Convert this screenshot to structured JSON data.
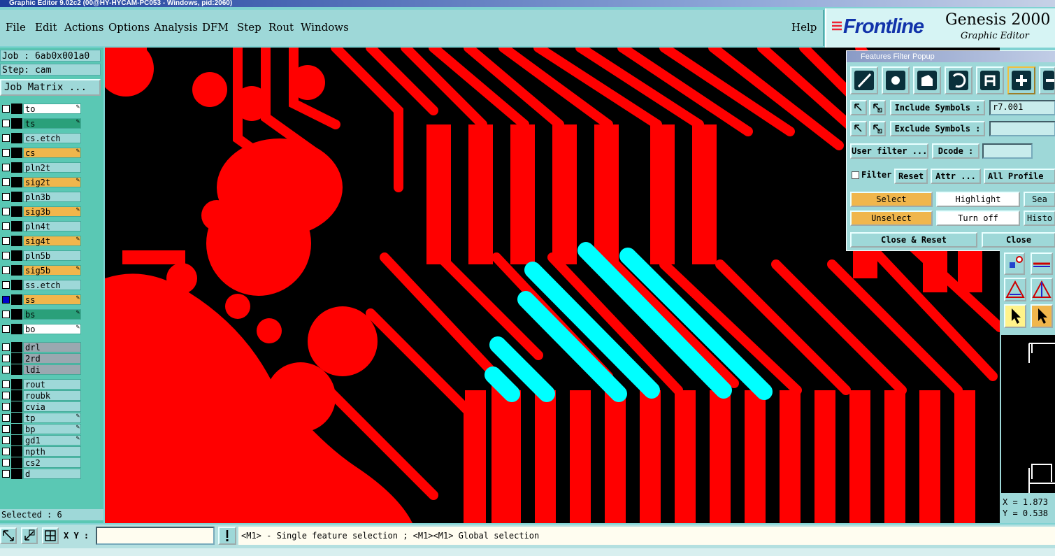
{
  "window": {
    "title": "Graphic Editor 9.02c2 (00@HY-HYCAM-PC053 - Windows, pid:2060)"
  },
  "menu": {
    "items": [
      "File",
      "Edit",
      "Actions",
      "Options",
      "Analysis",
      "DFM",
      "Step",
      "Rout",
      "Windows"
    ],
    "help": "Help"
  },
  "brand": {
    "logo": "Frontline",
    "product": "Genesis 2000",
    "subtitle": "Graphic Editor"
  },
  "job": {
    "job_label": "Job : 6ab0x001a0",
    "step_label": "Step: cam",
    "matrix_button": "Job Matrix ..."
  },
  "layers": [
    {
      "name": "to",
      "color": "#ffffff",
      "mark": "✎"
    },
    {
      "name": "ts",
      "color": "#2aa07a",
      "mark": "✎"
    },
    {
      "name": "cs.etch",
      "color": "#9ed8d8",
      "mark": ""
    },
    {
      "name": "cs",
      "color": "#f0b64c",
      "mark": "✎"
    },
    {
      "name": "pln2t",
      "color": "#9ed8d8",
      "mark": ""
    },
    {
      "name": "sig2t",
      "color": "#f0b64c",
      "mark": "✎"
    },
    {
      "name": "pln3b",
      "color": "#9ed8d8",
      "mark": ""
    },
    {
      "name": "sig3b",
      "color": "#f0b64c",
      "mark": "✎"
    },
    {
      "name": "pln4t",
      "color": "#9ed8d8",
      "mark": ""
    },
    {
      "name": "sig4t",
      "color": "#f0b64c",
      "mark": "✎"
    },
    {
      "name": "pln5b",
      "color": "#9ed8d8",
      "mark": ""
    },
    {
      "name": "sig5b",
      "color": "#f0b64c",
      "mark": "✎"
    },
    {
      "name": "ss.etch",
      "color": "#9ed8d8",
      "mark": ""
    },
    {
      "name": "ss",
      "color": "#f0b64c",
      "mark": "✎"
    },
    {
      "name": "bs",
      "color": "#2aa07a",
      "mark": "✎"
    },
    {
      "name": "bo",
      "color": "#ffffff",
      "mark": "✎"
    },
    {
      "name": "drl",
      "color": "#9aa8b0",
      "mark": ""
    },
    {
      "name": "2rd",
      "color": "#9aa8b0",
      "mark": ""
    },
    {
      "name": "ldi",
      "color": "#9aa8b0",
      "mark": ""
    },
    {
      "name": "rout",
      "color": "#9ed8d8",
      "mark": ""
    },
    {
      "name": "roubk",
      "color": "#9ed8d8",
      "mark": ""
    },
    {
      "name": "cvia",
      "color": "#9ed8d8",
      "mark": ""
    },
    {
      "name": "tp",
      "color": "#9ed8d8",
      "mark": "✎"
    },
    {
      "name": "bp",
      "color": "#9ed8d8",
      "mark": "✎"
    },
    {
      "name": "gd1",
      "color": "#9ed8d8",
      "mark": "✎"
    },
    {
      "name": "npth",
      "color": "#9ed8d8",
      "mark": ""
    },
    {
      "name": "cs2",
      "color": "#9ed8d8",
      "mark": ""
    },
    {
      "name": "d",
      "color": "#9ed8d8",
      "mark": ""
    }
  ],
  "selected": "Selected : 6",
  "popup": {
    "title": "Features Filter Popup",
    "include_label": "Include Symbols :",
    "include_value": "r7.001",
    "exclude_label": "Exclude Symbols :",
    "exclude_value": "",
    "user_filter": "User filter ...",
    "dcode": "Dcode :",
    "dcode_value": "",
    "filter": "Filter",
    "reset": "Reset",
    "attr": "Attr ...",
    "profile": "All Profile",
    "select": "Select",
    "highlight": "Highlight",
    "search": "Sea",
    "unselect": "Unselect",
    "turn_off": "Turn off",
    "histo": "Histo",
    "close_reset": "Close & Reset",
    "close": "Close"
  },
  "coords": {
    "x": "X = 1.873",
    "y": "Y = 0.538"
  },
  "bottom": {
    "xy_label": "X Y :",
    "xy_value": "",
    "hint": "<M1> - Single feature selection ; <M1><M1> Global selection"
  },
  "colors": {
    "trace": "#ff0000",
    "selected_feature": "#00ffff",
    "background": "#000000"
  }
}
